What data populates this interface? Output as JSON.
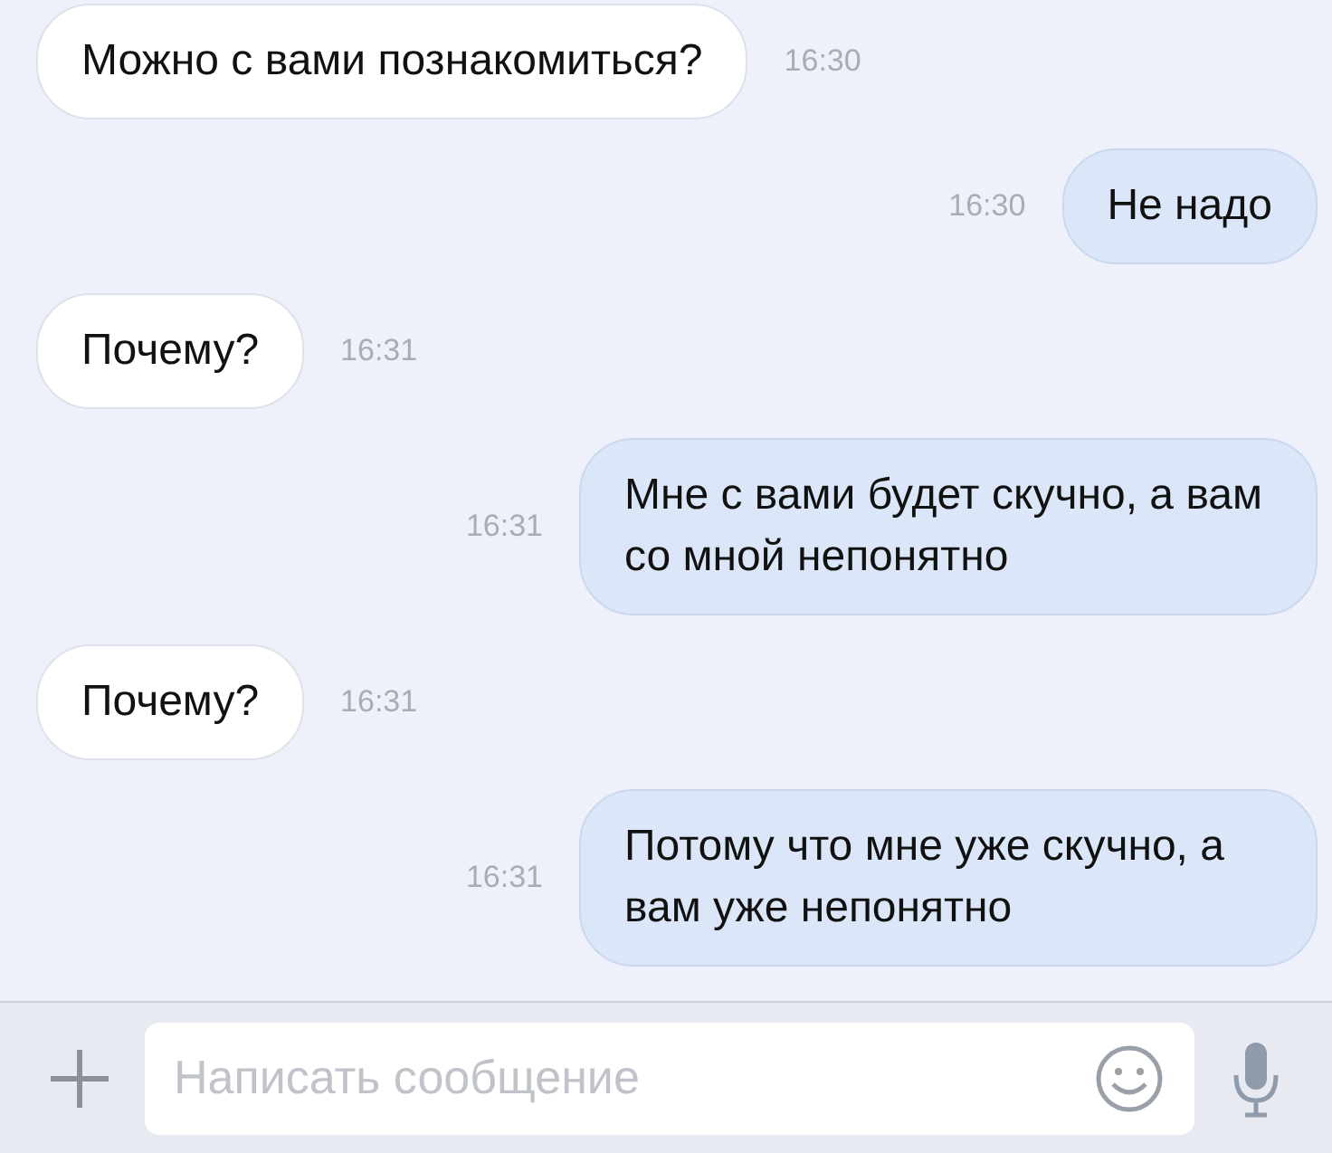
{
  "messages": [
    {
      "kind": "incoming",
      "text": "Можно с вами познакомиться?",
      "time": "16:30"
    },
    {
      "kind": "outgoing",
      "text": "Не надо",
      "time": "16:30"
    },
    {
      "kind": "incoming",
      "text": "Почему?",
      "time": "16:31"
    },
    {
      "kind": "outgoing",
      "text": "Мне с вами будет скучно, а вам со мной непонятно",
      "time": "16:31"
    },
    {
      "kind": "incoming",
      "text": "Почему?",
      "time": "16:31"
    },
    {
      "kind": "outgoing",
      "text": "Потому что мне уже скучно, а вам уже непонятно",
      "time": "16:31"
    }
  ],
  "composer": {
    "placeholder": "Написать сообщение"
  }
}
